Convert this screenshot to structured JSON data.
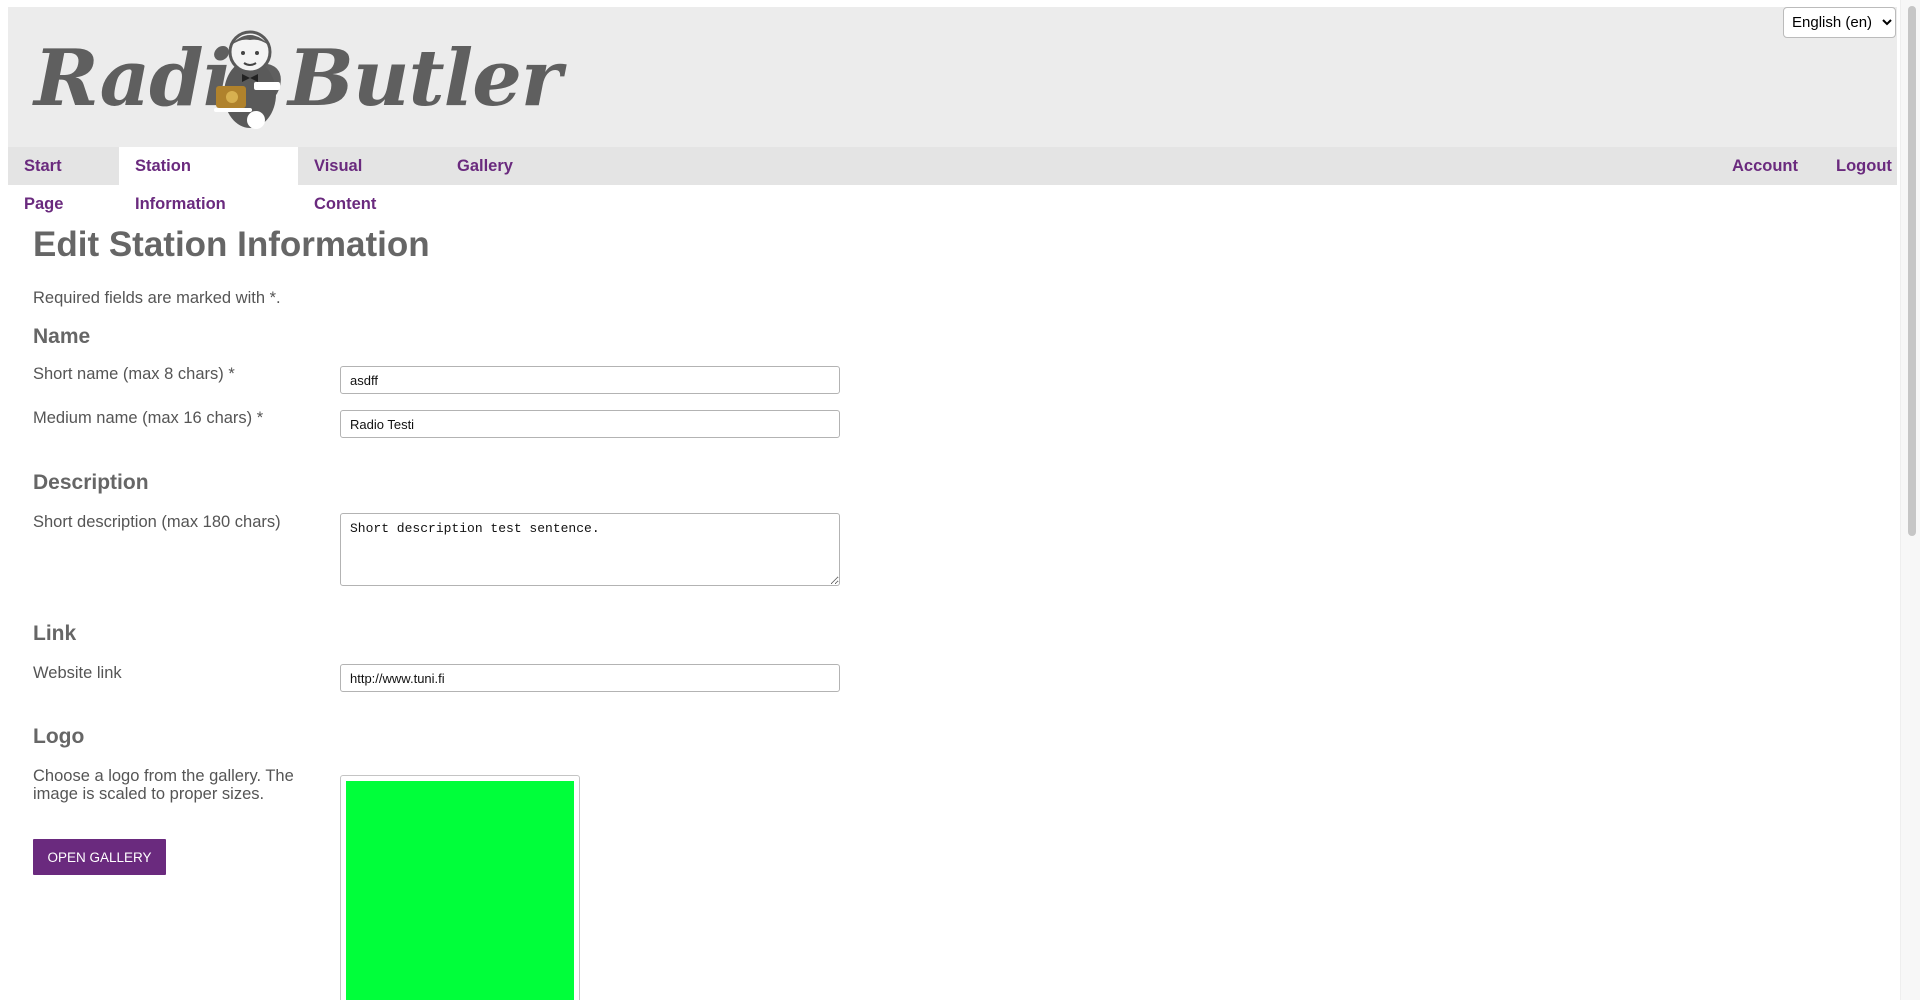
{
  "brand": {
    "word1": "Radio",
    "word2": "Butler"
  },
  "language": {
    "selected": "English (en)"
  },
  "nav": {
    "left": [
      {
        "label": "Start Page"
      },
      {
        "label": "Station Information",
        "active": true
      },
      {
        "label": "Visual Content"
      },
      {
        "label": "Gallery"
      }
    ],
    "right": [
      {
        "label": "Account"
      },
      {
        "label": "Logout"
      }
    ]
  },
  "page": {
    "title": "Edit Station Information",
    "required_note": "Required fields are marked with *."
  },
  "sections": {
    "name": {
      "heading": "Name",
      "short_label": "Short name (max 8 chars) *",
      "short_value": "asdff",
      "medium_label": "Medium name (max 16 chars) *",
      "medium_value": "Radio Testi"
    },
    "description": {
      "heading": "Description",
      "short_label": "Short description (max 180 chars)",
      "short_value": "Short description test sentence."
    },
    "link": {
      "heading": "Link",
      "website_label": "Website link",
      "website_value": "http://www.tuni.fi"
    },
    "logo": {
      "heading": "Logo",
      "help": "Choose a logo from the gallery. The image is scaled to proper sizes.",
      "button": "OPEN GALLERY",
      "preview_color": "#00ff3a"
    }
  },
  "colors": {
    "accent": "#6a2a7e",
    "header_bg": "#ececec",
    "nav_bg": "#e4e4e4"
  }
}
